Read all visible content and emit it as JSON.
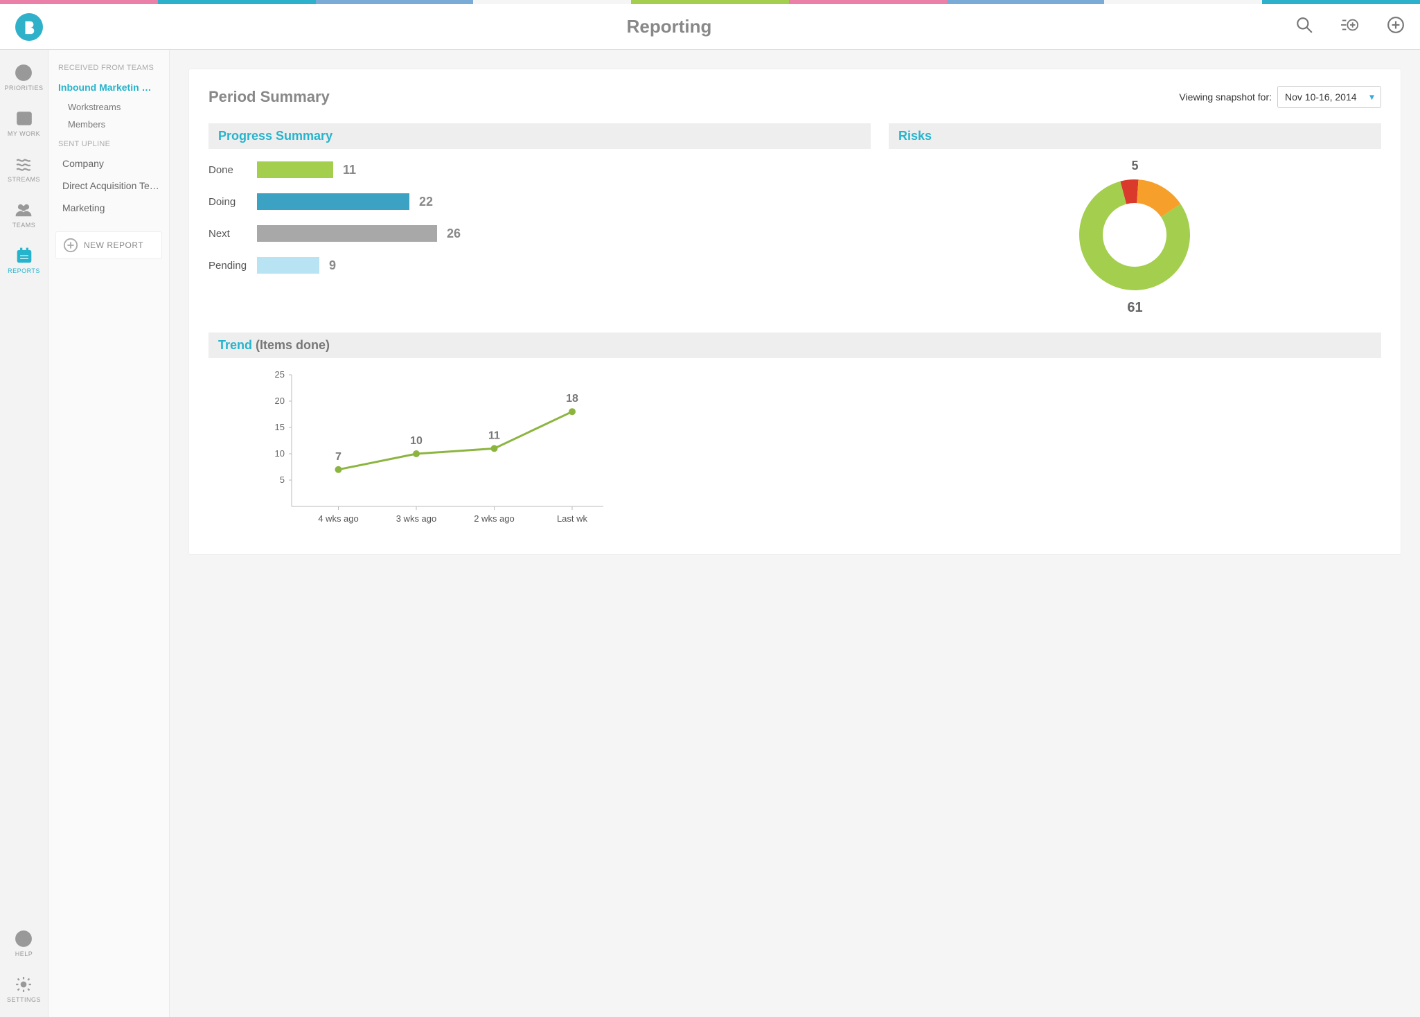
{
  "ribbon_colors": [
    "#ea7fa8",
    "#2db0cb",
    "#79abd6",
    "#f5f5f5",
    "#a4ce4e",
    "#ea7fa8",
    "#79abd6",
    "#f5f5f5",
    "#2db0cb"
  ],
  "header": {
    "title": "Reporting"
  },
  "rail": {
    "items": [
      {
        "id": "priorities",
        "label": "PRIORITIES"
      },
      {
        "id": "mywork",
        "label": "MY WORK"
      },
      {
        "id": "streams",
        "label": "STREAMS"
      },
      {
        "id": "teams",
        "label": "TEAMS"
      },
      {
        "id": "reports",
        "label": "REPORTS"
      }
    ],
    "footer": [
      {
        "id": "help",
        "label": "HELP"
      },
      {
        "id": "settings",
        "label": "SETTINGS"
      }
    ],
    "active": "reports"
  },
  "nav2": {
    "group1_label": "RECEIVED FROM TEAMS",
    "active": "Inbound Marketin …",
    "sublinks": [
      "Workstreams",
      "Members"
    ],
    "group2_label": "SENT UPLINE",
    "links": [
      "Company",
      "Direct Acquisition Te…",
      "Marketing"
    ],
    "new_report": "NEW REPORT"
  },
  "summary": {
    "title": "Period Summary",
    "snapshot_label": "Viewing snapshot for:",
    "snapshot_value": "Nov 10-16, 2014"
  },
  "progress": {
    "title": "Progress Summary",
    "max": 26,
    "rows": [
      {
        "label": "Done",
        "value": 11,
        "color": "#a4ce4e"
      },
      {
        "label": "Doing",
        "value": 22,
        "color": "#3ba2c4"
      },
      {
        "label": "Next",
        "value": 26,
        "color": "#a8a8a8"
      },
      {
        "label": "Pending",
        "value": 9,
        "color": "#b7e3f2"
      }
    ]
  },
  "risks": {
    "title": "Risks",
    "top_value": 5,
    "bottom_value": 61,
    "segments": [
      {
        "color": "#a4ce4e",
        "weight": 61
      },
      {
        "color": "#f6a02b",
        "weight": 11
      },
      {
        "color": "#d93a2b",
        "weight": 4
      }
    ]
  },
  "trend": {
    "title": "Trend",
    "subtitle": "(Items done)",
    "ylabel": "",
    "yticks": [
      5,
      10,
      15,
      20,
      25
    ]
  },
  "chart_data": {
    "type": "line",
    "categories": [
      "4 wks ago",
      "3 wks ago",
      "2 wks ago",
      "Last wk"
    ],
    "values": [
      7,
      10,
      11,
      18
    ],
    "title": "Trend (Items done)",
    "xlabel": "",
    "ylabel": "",
    "ylim": [
      0,
      25
    ]
  }
}
